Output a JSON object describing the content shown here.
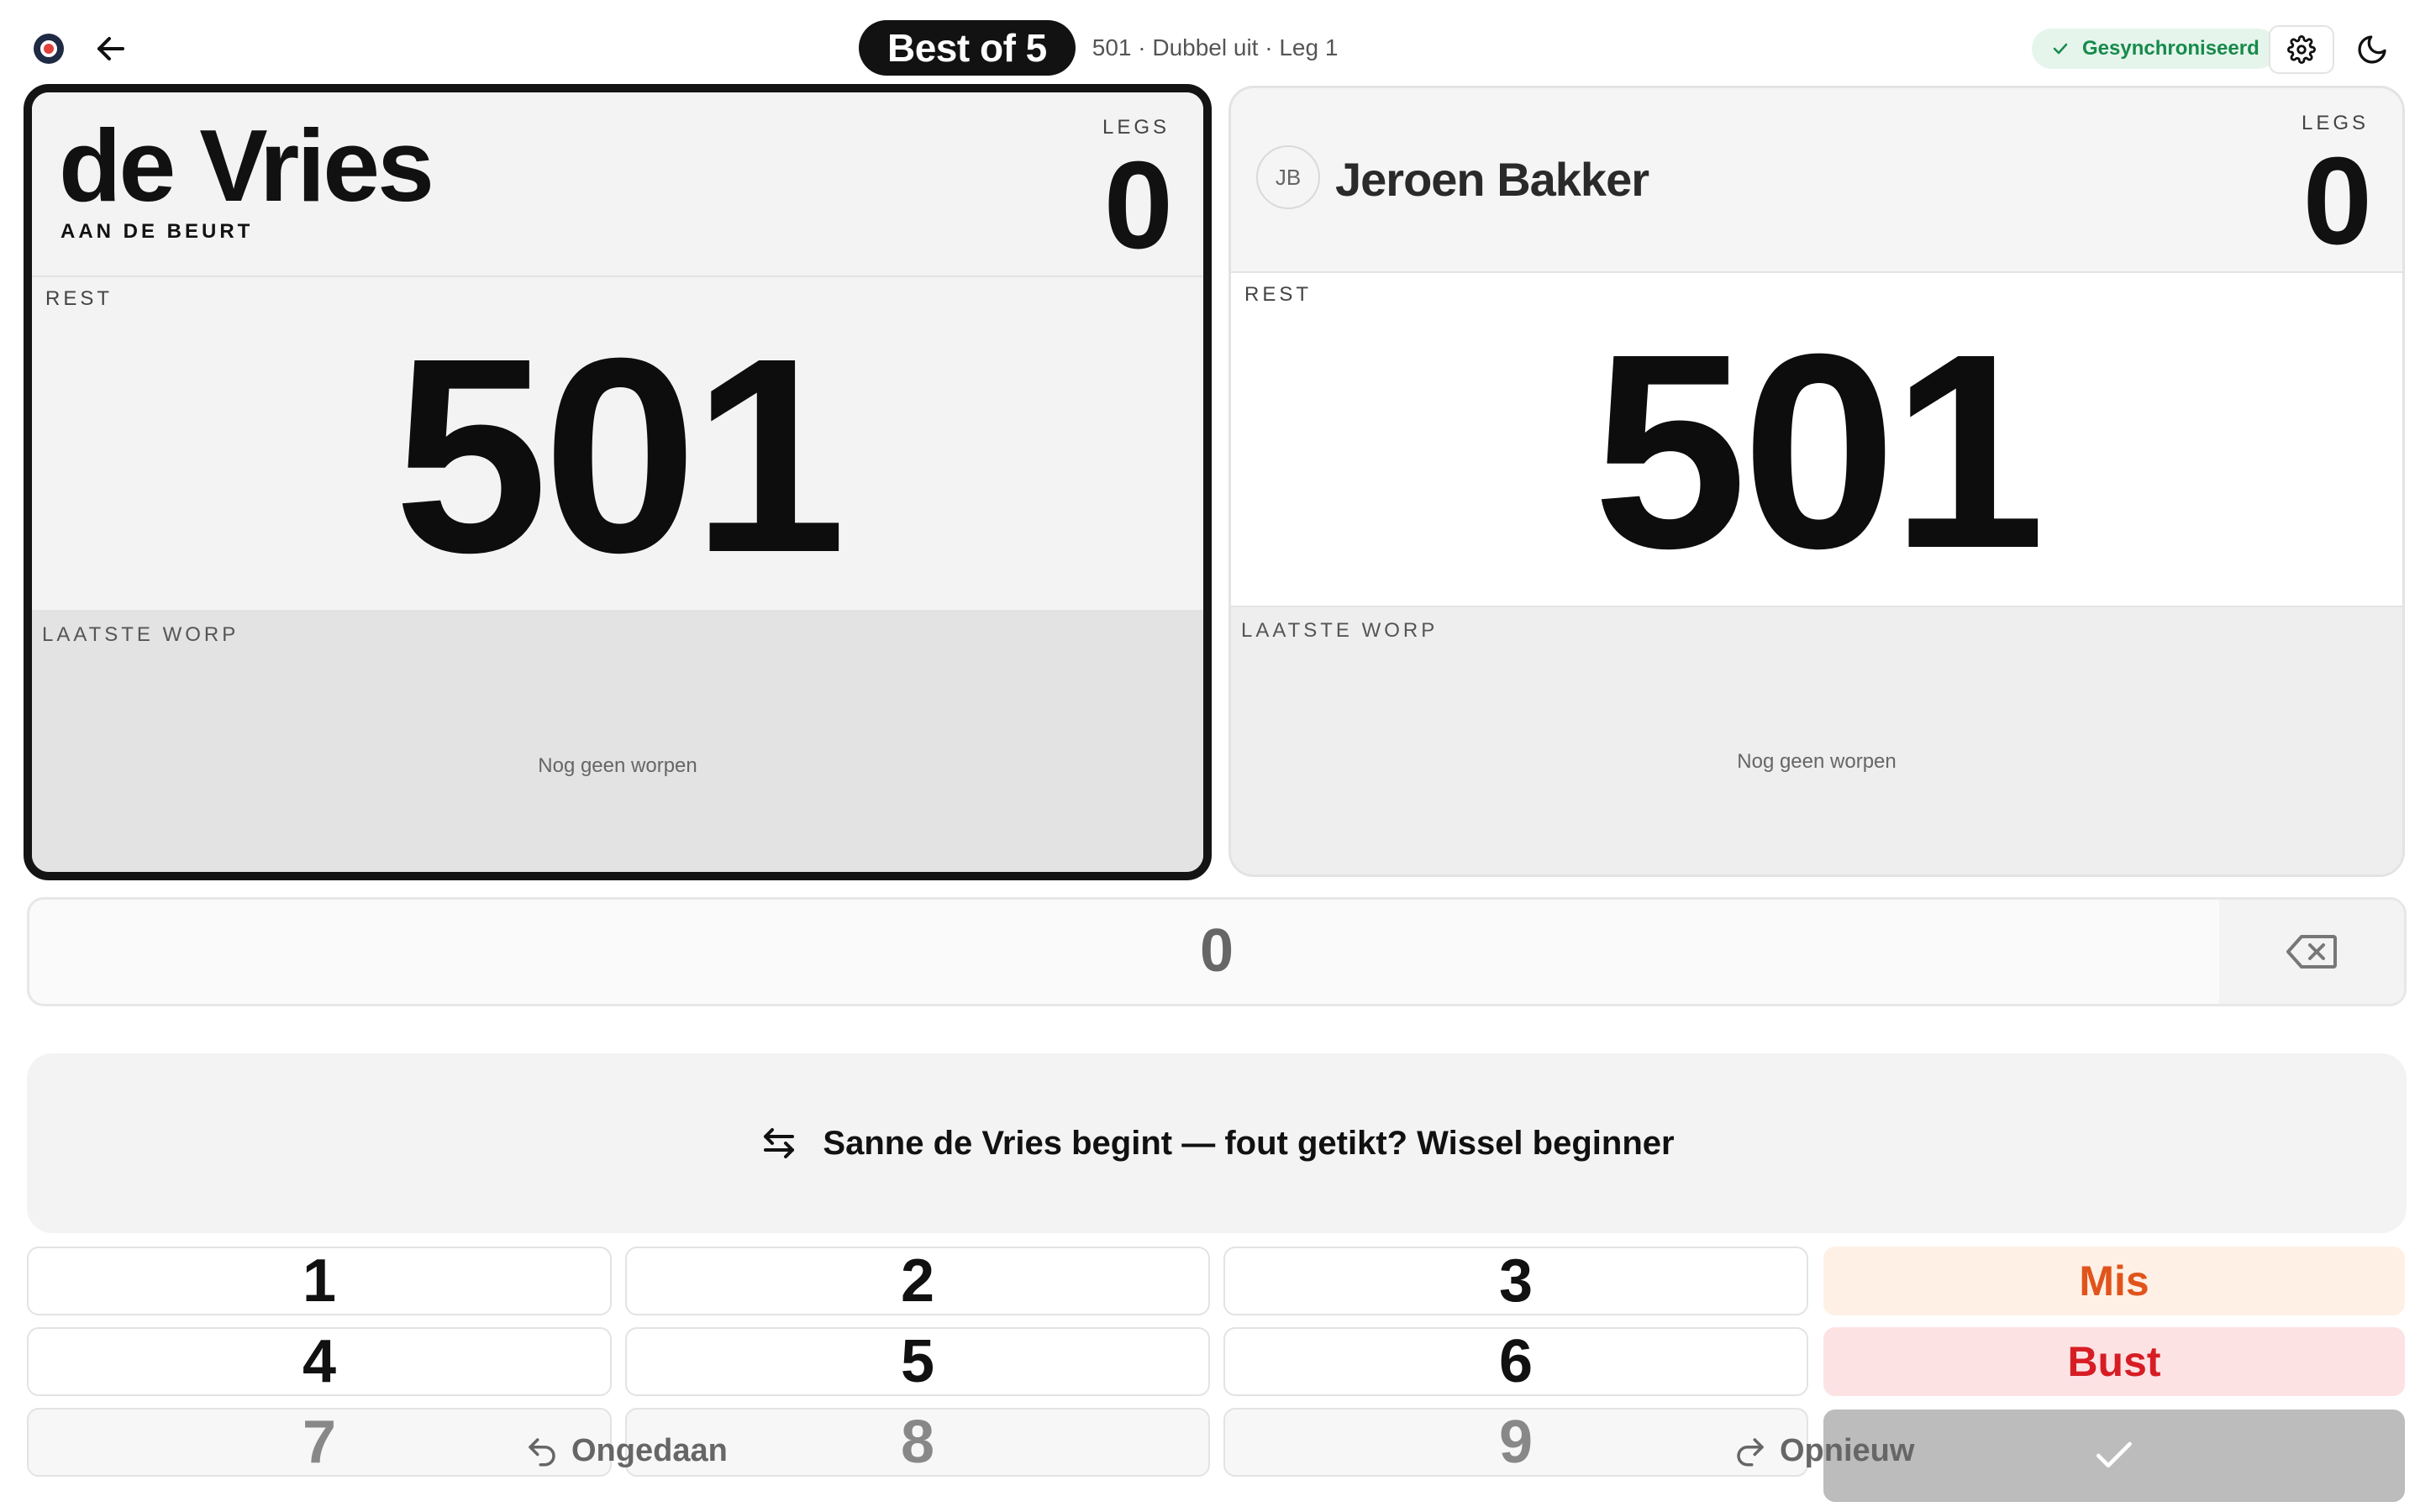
{
  "header": {
    "match_pill": "Best of 5",
    "match_info": "501 · Dubbel uit · Leg 1",
    "sync_status": "Gesynchroniseerd",
    "icons": {
      "logo": "dartboard-logo",
      "back": "arrow-left-icon",
      "settings": "gear-icon",
      "theme": "moon-icon",
      "sync": "check-icon"
    }
  },
  "players": [
    {
      "name": "de Vries",
      "turn_label": "AAN DE BEURT",
      "legs_label": "LEGS",
      "legs": "0",
      "rest_label": "REST",
      "rest": "501",
      "last_label": "LAATSTE WORP",
      "last_empty": "Nog geen worpen",
      "active": true
    },
    {
      "name": "Jeroen Bakker",
      "initials": "JB",
      "legs_label": "LEGS",
      "legs": "0",
      "rest_label": "REST",
      "rest": "501",
      "last_label": "LAATSTE WORP",
      "last_empty": "Nog geen worpen",
      "active": false
    }
  ],
  "input": {
    "value": "0"
  },
  "banner": {
    "text": "Sanne de Vries begint — fout getikt? Wissel beginner"
  },
  "keypad": {
    "digits": [
      "1",
      "2",
      "3",
      "4",
      "5",
      "6",
      "7",
      "8",
      "9"
    ],
    "mis": "Mis",
    "bust": "Bust",
    "undo": "Ongedaan",
    "redo": "Opnieuw"
  },
  "colors": {
    "accent_dark": "#121212",
    "sync_green": "#178a4b",
    "mis_orange": "#e0541b",
    "bust_red": "#d71d24"
  }
}
